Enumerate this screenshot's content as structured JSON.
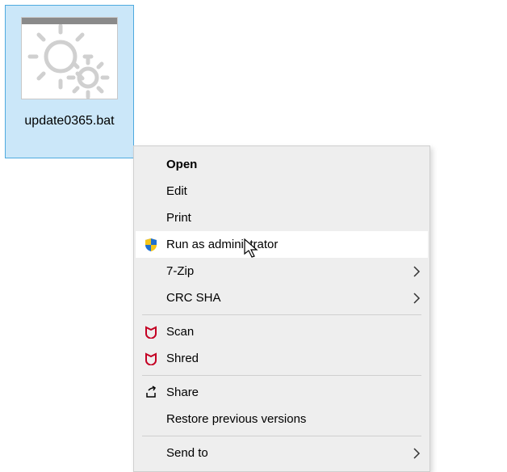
{
  "file": {
    "name": "update0365.bat"
  },
  "menu": {
    "open": "Open",
    "edit": "Edit",
    "print": "Print",
    "run_admin": "Run as administrator",
    "seven_zip": "7-Zip",
    "crc_sha": "CRC SHA",
    "scan": "Scan",
    "shred": "Shred",
    "share": "Share",
    "restore": "Restore previous versions",
    "send_to": "Send to"
  }
}
